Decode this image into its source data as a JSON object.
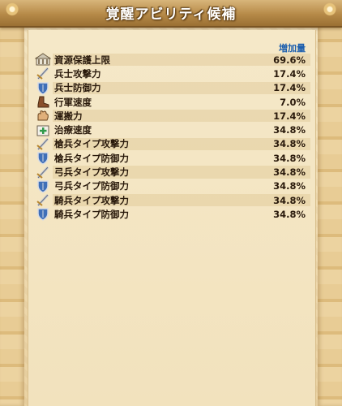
{
  "header": {
    "title": "覚醒アビリティ候補"
  },
  "table": {
    "column_header": "増加量",
    "rows": [
      {
        "icon": "building-icon",
        "label": "資源保護上限",
        "value": "69.6%"
      },
      {
        "icon": "sword-icon",
        "label": "兵士攻撃力",
        "value": "17.4%"
      },
      {
        "icon": "shield-icon",
        "label": "兵士防御力",
        "value": "17.4%"
      },
      {
        "icon": "boot-icon",
        "label": "行軍速度",
        "value": "7.0%"
      },
      {
        "icon": "hand-icon",
        "label": "運搬力",
        "value": "17.4%"
      },
      {
        "icon": "medkit-icon",
        "label": "治療速度",
        "value": "34.8%"
      },
      {
        "icon": "sword-icon",
        "label": "槍兵タイプ攻撃力",
        "value": "34.8%"
      },
      {
        "icon": "shield-icon",
        "label": "槍兵タイプ防御力",
        "value": "34.8%"
      },
      {
        "icon": "sword-icon",
        "label": "弓兵タイプ攻撃力",
        "value": "34.8%"
      },
      {
        "icon": "shield-icon",
        "label": "弓兵タイプ防御力",
        "value": "34.8%"
      },
      {
        "icon": "sword-icon",
        "label": "騎兵タイプ攻撃力",
        "value": "34.8%"
      },
      {
        "icon": "shield-icon",
        "label": "騎兵タイプ防御力",
        "value": "34.8%"
      }
    ]
  },
  "colors": {
    "header_text": "#ffffff",
    "column_header": "#1d5fae",
    "text": "#2a1a0c",
    "parchment": "#f2e2bd"
  }
}
